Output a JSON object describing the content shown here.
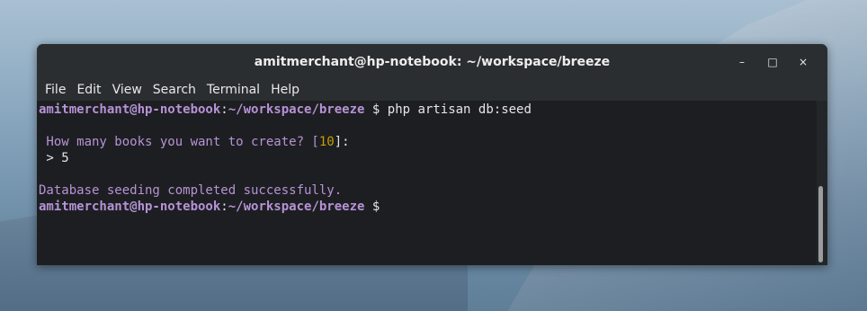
{
  "window": {
    "title": "amitmerchant@hp-notebook: ~/workspace/breeze",
    "controls": {
      "minimize": "–",
      "maximize": "□",
      "close": "×"
    }
  },
  "menu": {
    "items": [
      "File",
      "Edit",
      "View",
      "Search",
      "Terminal",
      "Help"
    ]
  },
  "terminal": {
    "prompt_user": "amitmerchant@hp-notebook",
    "prompt_path": "~/workspace/breeze",
    "prompt_symbol": "$",
    "command": "php artisan db:seed",
    "question_text": " How many books you want to create? [",
    "question_default": "10",
    "question_end": "]:",
    "answer": " > 5",
    "success": "Database seeding completed successfully."
  },
  "colors": {
    "prompt": "#b693d7",
    "default_value": "#c4a000",
    "background": "#232628"
  }
}
